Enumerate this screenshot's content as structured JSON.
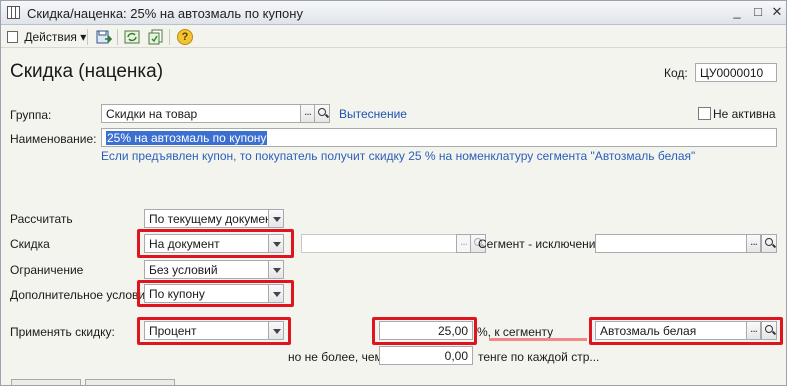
{
  "window": {
    "title": "Скидка/наценка: 25% на автозмаль по купону",
    "minimize": "_",
    "maximize": "□",
    "close": "✕"
  },
  "toolbar": {
    "actions_label": "Действия",
    "actions_arrow": "▾",
    "help_label": "?"
  },
  "form": {
    "title": "Скидка (наценка)",
    "code_label": "Код:",
    "code_value": "ЦУ0000010",
    "group_label": "Группа:",
    "group_value": "Скидки на товар",
    "displacement_link": "Вытеснение",
    "inactive_label": "Не активна",
    "name_label": "Наименование:",
    "name_value": "25% на автозмаль по купону",
    "hint": "Если предъявлен купон, то покупатель получит скидку 25 % на номенклатуру сегмента \"Автозмаль белая\"",
    "calculate_label": "Рассчитать",
    "calculate_value": "По текущему документу",
    "discount_label": "Скидка",
    "discount_value": "На документ",
    "segment_exclusion_label": "Сегмент - исключение",
    "restriction_label": "Ограничение",
    "restriction_value": "Без условий",
    "extra_condition_label": "Дополнительное условие",
    "extra_condition_value": "По купону",
    "apply_label": "Применять скидку:",
    "apply_value": "Процент",
    "amount_value": "25,00",
    "to_segment_label": "%, к сегменту",
    "segment_value": "Автозмаль белая",
    "no_more_label": "но не более, чем",
    "limit_value": "0,00",
    "per_item_label": "тенге по каждой стр..."
  }
}
